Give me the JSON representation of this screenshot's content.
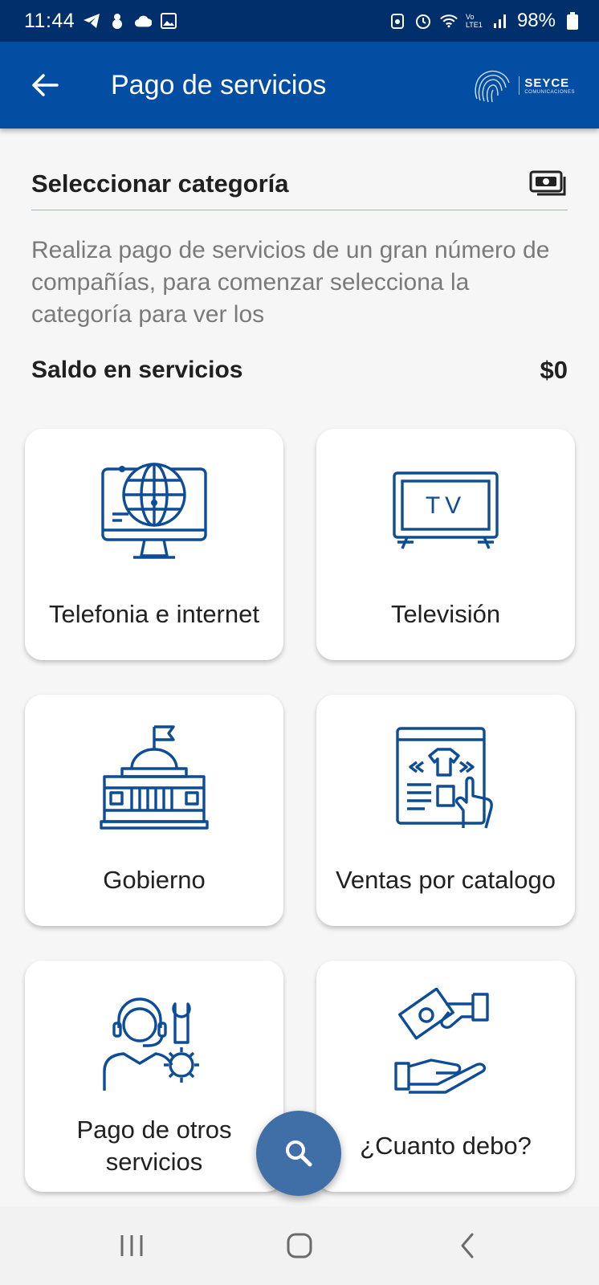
{
  "status_bar": {
    "time": "11:44",
    "battery": "98%",
    "left_icons": [
      "telegram-icon",
      "bug-icon",
      "cloud-icon",
      "image-icon"
    ],
    "right_icons": [
      "wifi-data-icon",
      "alarm-icon",
      "wifi-icon",
      "volte-icon",
      "signal-icon",
      "battery-icon"
    ],
    "volte_label": "Vo LTE1"
  },
  "app_bar": {
    "title": "Pago de servicios",
    "logo_text": "SEYCE",
    "logo_sub": "COMUNICACIONES",
    "back_icon": "arrow-left-icon",
    "color": "#034ea2"
  },
  "main": {
    "section_title": "Seleccionar categoría",
    "section_icon": "cash-icon",
    "description": "Realiza pago de servicios de un gran número de compañías, para comenzar selecciona la categoría para ver los",
    "balance_label": "Saldo en servicios",
    "balance_value": "$0"
  },
  "categories": [
    {
      "label": "Telefonia e internet",
      "icon": "globe-monitor-icon"
    },
    {
      "label": "Televisión",
      "icon": "tv-icon",
      "tv_text": "TV"
    },
    {
      "label": "Gobierno",
      "icon": "government-building-icon"
    },
    {
      "label": "Ventas por catalogo",
      "icon": "catalog-shop-icon"
    },
    {
      "label": "Pago de otros servicios",
      "icon": "support-agent-gear-icon"
    },
    {
      "label": "¿Cuanto debo?",
      "icon": "hand-money-icon"
    }
  ],
  "fab": {
    "icon": "search-icon"
  },
  "nav_bar": {
    "icons": [
      "recent-apps-icon",
      "home-icon",
      "back-icon"
    ]
  },
  "colors": {
    "accent": "#034ea2",
    "status_bar": "#002f6c",
    "icon_blue": "#0d4c97",
    "fab": "#3f6fa6"
  }
}
